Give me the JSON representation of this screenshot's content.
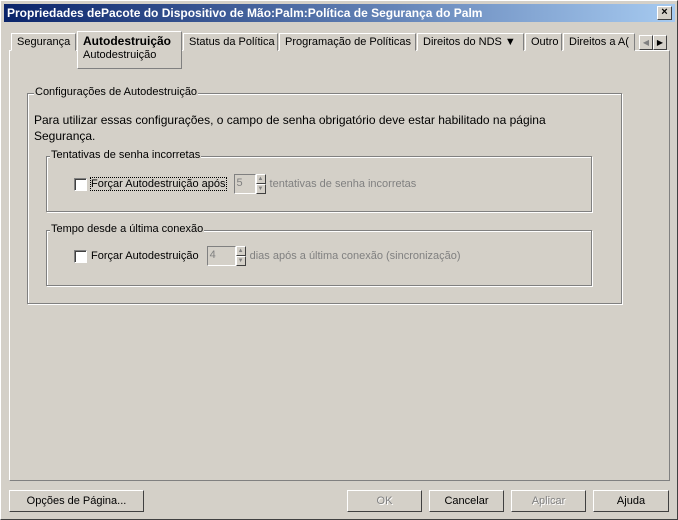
{
  "window": {
    "title": "Propriedades dePacote do Dispositivo de Mão:Palm:Política de Segurança do Palm",
    "close": "×"
  },
  "tabs": [
    {
      "label": "Segurança"
    },
    {
      "label": "Autodestruição",
      "sub": "Autodestruição"
    },
    {
      "label": "Status da Política"
    },
    {
      "label": "Programação de Políticas"
    },
    {
      "label": "Direitos do NDS ▼"
    },
    {
      "label": "Outro"
    },
    {
      "label": "Direitos a A("
    }
  ],
  "tab_scroll": {
    "left": "◀",
    "right": "▶"
  },
  "main": {
    "group_title": "Configurações de Autodestruição",
    "description": "Para utilizar essas configurações, o campo de senha obrigatório deve estar habilitado na página Segurança.",
    "attempts": {
      "title": "Tentativas de senha incorretas",
      "checkbox_label": "Forçar Autodestruição após",
      "checked": false,
      "value": "5",
      "suffix": "tentativas de senha incorretas"
    },
    "since": {
      "title": "Tempo desde a última conexão",
      "checkbox_label": "Forçar Autodestruição",
      "checked": false,
      "value": "4",
      "suffix": "dias após a última conexão (sincronização)"
    }
  },
  "buttons": {
    "page_options": "Opções de Página...",
    "ok": "OK",
    "cancel": "Cancelar",
    "apply": "Aplicar",
    "help": "Ajuda"
  }
}
